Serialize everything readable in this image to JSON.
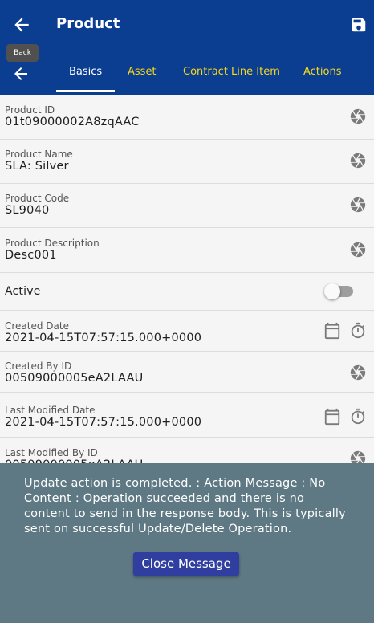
{
  "appbar": {
    "title": "Product",
    "back_tooltip": "Back"
  },
  "tabs": [
    "Basics",
    "Asset",
    "Contract Line Item",
    "Actions"
  ],
  "fields": {
    "product_id": {
      "label": "Product ID",
      "value": "01t09000002A8zqAAC"
    },
    "product_name": {
      "label": "Product Name",
      "value": "SLA: Silver"
    },
    "product_code": {
      "label": "Product Code",
      "value": "SL9040"
    },
    "product_description": {
      "label": "Product Description",
      "value": "Desc001"
    },
    "active": {
      "label": "Active",
      "checked": false
    },
    "created_date": {
      "label": "Created Date",
      "value": "2021-04-15T07:57:15.000+0000"
    },
    "created_by_id": {
      "label": "Created By ID",
      "value": "00509000005eA2LAAU"
    },
    "last_modified_date": {
      "label": "Last Modified Date",
      "value": "2021-04-15T07:57:15.000+0000"
    },
    "last_modified_by_id": {
      "label": "Last Modified By ID",
      "value": "00509000005eA2LAAU"
    }
  },
  "message": {
    "text": "Update action is completed.  : Action Message : No Content : Operation succeeded and there is no content to send in the response body. This is typically sent on successful Update/Delete Operation.",
    "close_label": "Close Message"
  },
  "colors": {
    "appbar": "#0b3d91",
    "tab_inactive": "#f6d91c",
    "overlay": "#5e7983",
    "close_button": "#303f9f"
  },
  "icons": [
    "back-arrow-icon",
    "save-icon",
    "aperture-icon",
    "calendar-icon",
    "stopwatch-icon"
  ]
}
